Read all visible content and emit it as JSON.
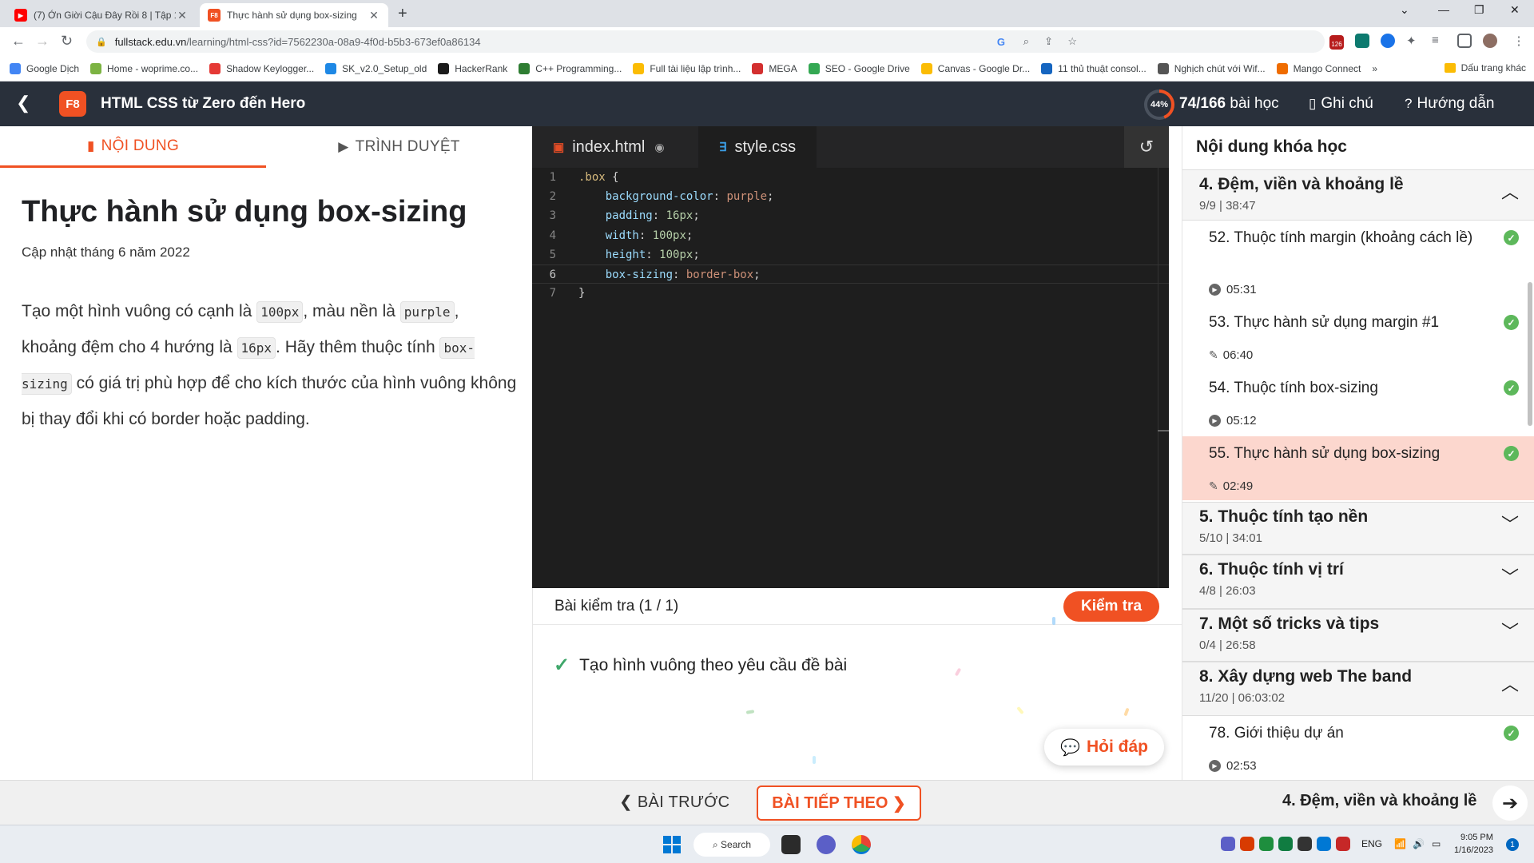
{
  "browser": {
    "tabs": [
      {
        "title": "(7) Ớn Giời Cậu Đây Rồi 8 | Tập 1",
        "favicon": "youtube-icon"
      },
      {
        "title": "Thực hành sử dụng box-sizing",
        "favicon": "f8-icon",
        "favicon_text": "F8"
      }
    ],
    "url_host": "fullstack.edu.vn",
    "url_path": "/learning/html-css?id=7562230a-08a9-4f0d-b5b3-673ef0a86134",
    "extension_badge": "126",
    "bookmarks": [
      {
        "label": "Google Dịch",
        "color": "#4285f4"
      },
      {
        "label": "Home - woprime.co...",
        "color": "#7cb342"
      },
      {
        "label": "Shadow Keylogger...",
        "color": "#e53935"
      },
      {
        "label": "SK_v2.0_Setup_old",
        "color": "#1e88e5"
      },
      {
        "label": "HackerRank",
        "color": "#1b1b1b"
      },
      {
        "label": "C++ Programming...",
        "color": "#2e7d32"
      },
      {
        "label": "Full tài liệu lập trình...",
        "color": "#fbbc04"
      },
      {
        "label": "MEGA",
        "color": "#d32f2f"
      },
      {
        "label": "SEO - Google Drive",
        "color": "#34a853"
      },
      {
        "label": "Canvas - Google Dr...",
        "color": "#fbbc04"
      },
      {
        "label": "11 thủ thuật consol...",
        "color": "#1565c0"
      },
      {
        "label": "Nghịch chút với Wif...",
        "color": "#555555"
      },
      {
        "label": "Mango Connect",
        "color": "#ef6c00"
      }
    ],
    "bookmarks_more": "»",
    "bookmarks_folder": "Dấu trang khác"
  },
  "header": {
    "logo_text": "F8",
    "course_title": "HTML CSS từ Zero đến Hero",
    "progress_percent": 44,
    "progress_label": "44%",
    "lessons_done": "74/166",
    "lessons_suffix": "bài học",
    "notes_label": "Ghi chú",
    "guide_label": "Hướng dẫn",
    "accent": "#f05123"
  },
  "left": {
    "tab_content": "NỘI DUNG",
    "tab_browser": "TRÌNH DUYỆT",
    "lesson_title": "Thực hành sử dụng box-sizing",
    "updated": "Cập nhật tháng 6 năm 2022",
    "desc": {
      "p1": "Tạo một hình vuông có cạnh là ",
      "c1": "100px",
      "p2": ", màu nền là ",
      "c2": "purple",
      "p3": ", khoảng đệm cho 4 hướng là ",
      "c3": "16px",
      "p4": ". Hãy thêm thuộc tính ",
      "c4": "box-sizing",
      "p5": " có giá trị phù hợp để cho kích thước của hình vuông không bị thay đổi khi có border hoặc padding."
    }
  },
  "editor": {
    "tab_html": "index.html",
    "tab_css": "style.css",
    "reset_icon": "↺",
    "lines": [
      {
        "num": "1",
        "sel": ".box",
        "open": " {"
      },
      {
        "num": "2",
        "prop": "background-color",
        "val": "purple",
        "type": "kw"
      },
      {
        "num": "3",
        "prop": "padding",
        "val": "16px",
        "type": "num"
      },
      {
        "num": "4",
        "prop": "width",
        "val": "100px",
        "type": "num"
      },
      {
        "num": "5",
        "prop": "height",
        "val": "100px",
        "type": "num"
      },
      {
        "num": "6",
        "prop": "box-sizing",
        "val": "border-box",
        "type": "kw"
      },
      {
        "num": "7",
        "close": "}"
      }
    ]
  },
  "test": {
    "title": "Bài kiểm tra (1 / 1)",
    "check_label": "Kiểm tra",
    "items": [
      "Tạo hình vuông theo yêu cầu đề bài"
    ],
    "qa_label": "Hỏi đáp"
  },
  "sidebar": {
    "title": "Nội dung khóa học",
    "sections": [
      {
        "name": "4. Đệm, viền và khoảng lề",
        "meta": "9/9 | 38:47",
        "expanded": true
      },
      {
        "name": "5. Thuộc tính tạo nền",
        "meta": "5/10 | 34:01",
        "expanded": false
      },
      {
        "name": "6. Thuộc tính vị trí",
        "meta": "4/8 | 26:03",
        "expanded": false
      },
      {
        "name": "7. Một số tricks và tips",
        "meta": "0/4 | 26:58",
        "expanded": false
      },
      {
        "name": "8. Xây dựng web The band",
        "meta": "11/20 | 06:03:02",
        "expanded": true
      }
    ],
    "lessons": [
      {
        "name": "52. Thuộc tính margin (khoảng cách lề)",
        "time": "05:31",
        "kind": "video",
        "done": true
      },
      {
        "name": "53. Thực hành sử dụng margin #1",
        "time": "06:40",
        "kind": "practice",
        "done": true
      },
      {
        "name": "54. Thuộc tính box-sizing",
        "time": "05:12",
        "kind": "video",
        "done": true
      },
      {
        "name": "55. Thực hành sử dụng box-sizing",
        "time": "02:49",
        "kind": "practice",
        "done": true,
        "active": true
      },
      {
        "name": "78. Giới thiệu dự án",
        "time": "02:53",
        "kind": "video",
        "done": true
      }
    ]
  },
  "bottom": {
    "prev_label": "BÀI TRƯỚC",
    "next_label": "BÀI TIẾP THEO",
    "section_label": "4. Đệm, viền và khoảng lề"
  },
  "taskbar": {
    "search_label": "Search",
    "lang": "ENG",
    "time": "9:05 PM",
    "date": "1/16/2023",
    "notifications": "1"
  }
}
